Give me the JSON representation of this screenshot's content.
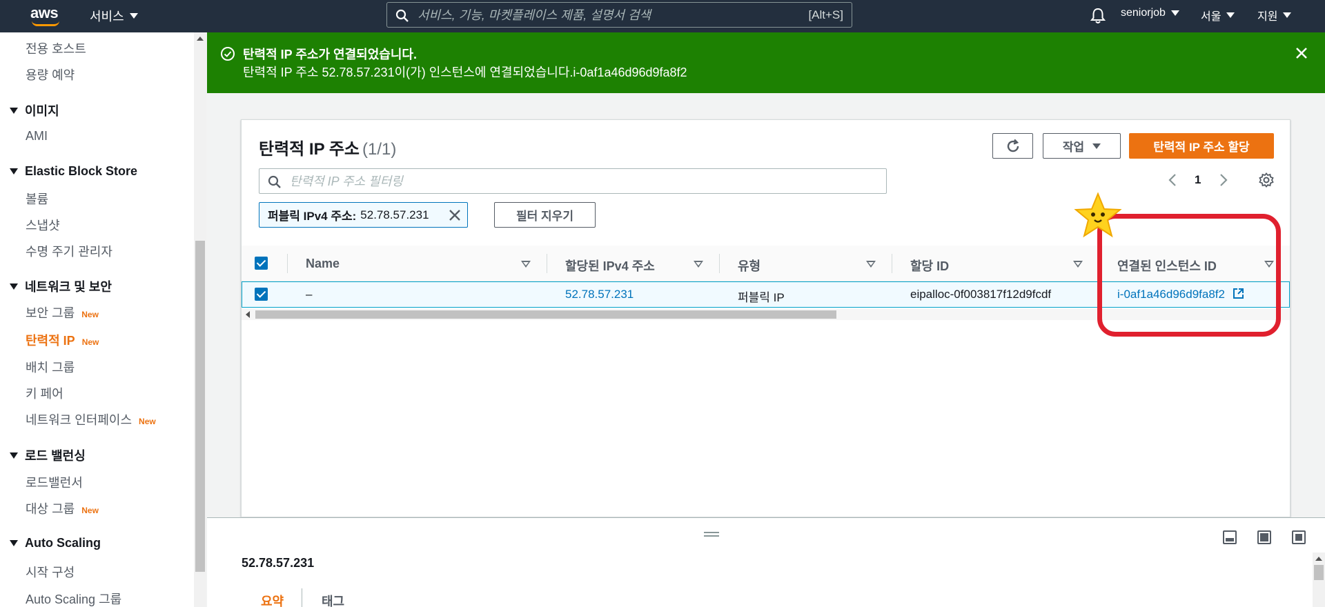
{
  "topnav": {
    "logo": "aws",
    "services_label": "서비스",
    "search_placeholder": "서비스, 기능, 마켓플레이스 제품, 설명서 검색",
    "search_shortcut": "[Alt+S]",
    "account": "seniorjob",
    "region": "서울",
    "support": "지원",
    "icons": [
      "search-icon",
      "bell-icon"
    ]
  },
  "sidebar": {
    "items_top": [
      "전용 호스트",
      "용량 예약"
    ],
    "sections": [
      {
        "title": "이미지",
        "items": [
          "AMI"
        ]
      },
      {
        "title": "Elastic Block Store",
        "items": [
          "볼륨",
          "스냅샷",
          "수명 주기 관리자"
        ]
      },
      {
        "title": "네트워크 및 보안",
        "items": [
          "보안 그룹",
          "탄력적 IP",
          "배치 그룹",
          "키 페어",
          "네트워크 인터페이스"
        ]
      },
      {
        "title": "로드 밸런싱",
        "items": [
          "로드밸런서",
          "대상 그룹"
        ]
      },
      {
        "title": "Auto Scaling",
        "items": [
          "시작 구성",
          "Auto Scaling 그룹"
        ]
      }
    ],
    "new_badge": "New",
    "active_item": "탄력적 IP"
  },
  "flash": {
    "title": "탄력적 IP 주소가 연결되었습니다.",
    "message": "탄력적 IP 주소 52.78.57.231이(가) 인스턴스에 연결되었습니다.i-0af1a46d96d9fa8f2",
    "color": "#1d8102"
  },
  "panel": {
    "title": "탄력적 IP 주소",
    "count": "(1/1)",
    "actions_label": "작업",
    "allocate_label": "탄력적 IP 주소 할당",
    "filter_placeholder": "탄력적 IP 주소 필터링",
    "page": "1",
    "token_key": "퍼블릭 IPv4 주소:",
    "token_value": "52.78.57.231",
    "clear_filters": "필터 지우기"
  },
  "table": {
    "columns": [
      "Name",
      "할당된 IPv4 주소",
      "유형",
      "할당 ID",
      "연결된 인스턴스 ID"
    ],
    "rows": [
      {
        "name": "–",
        "ipv4": "52.78.57.231",
        "type": "퍼블릭 IP",
        "allocation_id": "eipalloc-0f003817f12d9fcdf",
        "instance_id": "i-0af1a46d96d9fa8f2"
      }
    ]
  },
  "split_panel": {
    "title": "52.78.57.231",
    "tabs": [
      "요약",
      "태그"
    ]
  },
  "colors": {
    "accent": "#ec7211",
    "link": "#0073bb",
    "nav_bg": "#232f3e",
    "annotation": "#e0202e"
  }
}
